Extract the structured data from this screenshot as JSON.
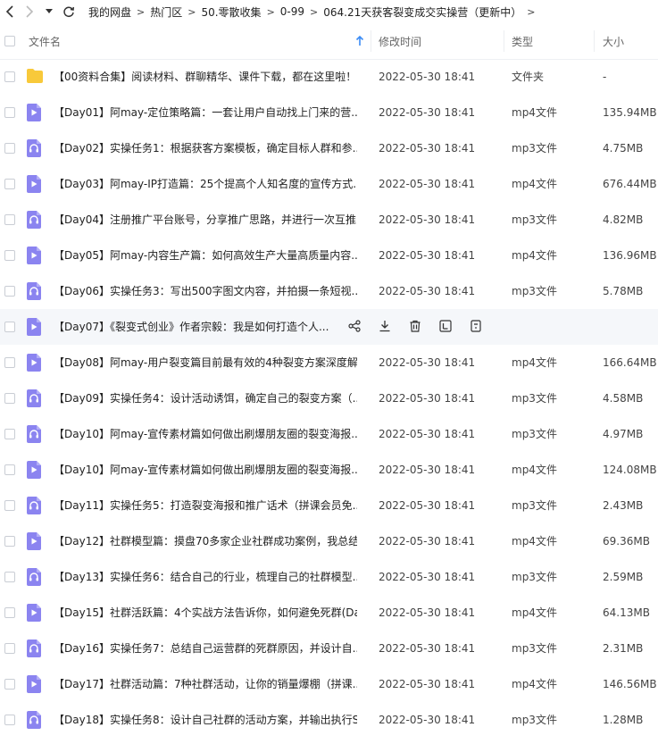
{
  "breadcrumb": [
    "我的网盘",
    "热门区",
    "50.零散收集",
    "0-99",
    "064.21天获客裂变成交实操营（更新中）"
  ],
  "header": {
    "name": "文件名",
    "time": "修改时间",
    "type": "类型",
    "size": "大小"
  },
  "files": [
    {
      "name": "【00资料合集】阅读材料、群聊精华、课件下载，都在这里啦！",
      "time": "2022-05-30 18:41",
      "type": "文件夹",
      "size": "-",
      "kind": "folder"
    },
    {
      "name": "【Day01】阿may-定位策略篇：一套让用户自动找上门来的营...",
      "time": "2022-05-30 18:41",
      "type": "mp4文件",
      "size": "135.94MB",
      "kind": "video"
    },
    {
      "name": "【Day02】实操任务1：根据获客方案模板，确定目标人群和参...",
      "time": "2022-05-30 18:41",
      "type": "mp3文件",
      "size": "4.75MB",
      "kind": "audio"
    },
    {
      "name": "【Day03】阿may-IP打造篇：25个提高个人知名度的宣传方式...",
      "time": "2022-05-30 18:41",
      "type": "mp4文件",
      "size": "676.44MB",
      "kind": "video"
    },
    {
      "name": "【Day04】注册推广平台账号，分享推广思路，并进行一次互推...",
      "time": "2022-05-30 18:41",
      "type": "mp3文件",
      "size": "4.82MB",
      "kind": "audio"
    },
    {
      "name": "【Day05】阿may-内容生产篇：如何高效生产大量高质量内容...",
      "time": "2022-05-30 18:41",
      "type": "mp4文件",
      "size": "136.96MB",
      "kind": "video"
    },
    {
      "name": "【Day06】实操任务3：写出500字图文内容，并拍摄一条短视...",
      "time": "2022-05-30 18:41",
      "type": "mp3文件",
      "size": "5.78MB",
      "kind": "audio"
    },
    {
      "name": "【Day07】《裂变式创业》作者宗毅：我是如何打造个人...",
      "time": "",
      "type": "",
      "size": "",
      "kind": "video",
      "hover": true
    },
    {
      "name": "【Day08】阿may-用户裂变篇目前最有效的4种裂变方案深度解...",
      "time": "2022-05-30 18:41",
      "type": "mp4文件",
      "size": "166.64MB",
      "kind": "video"
    },
    {
      "name": "【Day09】实操任务4：设计活动诱饵，确定自己的裂变方案（...",
      "time": "2022-05-30 18:41",
      "type": "mp3文件",
      "size": "4.58MB",
      "kind": "audio"
    },
    {
      "name": "【Day10】阿may-宣传素材篇如何做出刷爆朋友圈的裂变海报...",
      "time": "2022-05-30 18:41",
      "type": "mp3文件",
      "size": "4.97MB",
      "kind": "audio"
    },
    {
      "name": "【Day10】阿may-宣传素材篇如何做出刷爆朋友圈的裂变海报...",
      "time": "2022-05-30 18:41",
      "type": "mp4文件",
      "size": "124.08MB",
      "kind": "video"
    },
    {
      "name": "【Day11】实操任务5：打造裂变海报和推广话术（拼课会员免...",
      "time": "2022-05-30 18:41",
      "type": "mp3文件",
      "size": "2.43MB",
      "kind": "audio"
    },
    {
      "name": "【Day12】社群模型篇：摸盘70多家企业社群成功案例，我总结...",
      "time": "2022-05-30 18:41",
      "type": "mp4文件",
      "size": "69.36MB",
      "kind": "video"
    },
    {
      "name": "【Day13】实操任务6：结合自己的行业，梳理自己的社群模型...",
      "time": "2022-05-30 18:41",
      "type": "mp3文件",
      "size": "2.59MB",
      "kind": "audio"
    },
    {
      "name": "【Day15】社群活跃篇：4个实战方法告诉你，如何避免死群(Da...",
      "time": "2022-05-30 18:41",
      "type": "mp4文件",
      "size": "64.13MB",
      "kind": "video"
    },
    {
      "name": "【Day16】实操任务7：总结自己运营群的死群原因，并设计自...",
      "time": "2022-05-30 18:41",
      "type": "mp3文件",
      "size": "2.31MB",
      "kind": "audio"
    },
    {
      "name": "【Day17】社群活动篇：7种社群活动，让你的销量爆棚（拼课...",
      "time": "2022-05-30 18:41",
      "type": "mp4文件",
      "size": "146.56MB",
      "kind": "video"
    },
    {
      "name": "【Day18】实操任务8：设计自己社群的活动方案，并输出执行S...",
      "time": "2022-05-30 18:41",
      "type": "mp3文件",
      "size": "1.28MB",
      "kind": "audio"
    }
  ],
  "colors": {
    "folder": "#f8c93a",
    "media": "#8b84f0",
    "sort_arrow": "#3b8cf5"
  }
}
